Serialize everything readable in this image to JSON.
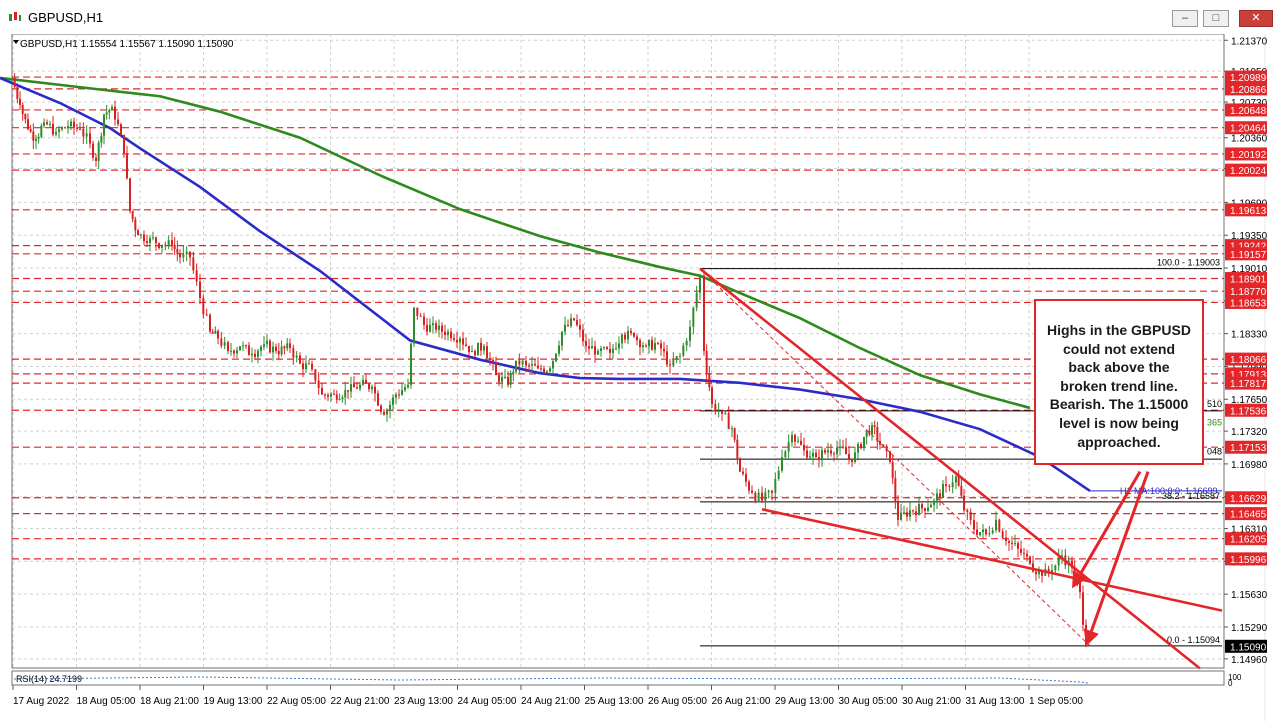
{
  "window": {
    "title": "GBPUSD,H1",
    "buttons": [
      "minimize",
      "maximize",
      "close"
    ]
  },
  "colors": {
    "price_line": "#e3262a",
    "ma100": "#2b2bc9",
    "ma200": "#2f8a1e",
    "grid": "#c8c8c8",
    "candle_up": "#2e8b2e",
    "candle_down": "#d92020"
  },
  "chart_data": {
    "type": "candlestick",
    "symbol_header": "GBPUSD,H1  1.15554 1.15567 1.15090 1.15090",
    "ylim": [
      1.14865,
      1.21435
    ],
    "y_ticks": [
      "1.21370",
      "1.21050",
      "1.20730",
      "1.20360",
      "1.20040",
      "1.19690",
      "1.19350",
      "1.19010",
      "1.18670",
      "1.18330",
      "1.17990",
      "1.17650",
      "1.17320",
      "1.16980",
      "1.16640",
      "1.16310",
      "1.15970",
      "1.15630",
      "1.15290",
      "1.14960"
    ],
    "x_ticks": [
      "17 Aug 2022",
      "18 Aug 05:00",
      "18 Aug 21:00",
      "19 Aug 13:00",
      "22 Aug 05:00",
      "22 Aug 21:00",
      "23 Aug 13:00",
      "24 Aug 05:00",
      "24 Aug 21:00",
      "25 Aug 13:00",
      "26 Aug 05:00",
      "26 Aug 21:00",
      "29 Aug 13:00",
      "30 Aug 05:00",
      "30 Aug 21:00",
      "31 Aug 13:00",
      "1 Sep 05:00"
    ],
    "horizontal_levels": [
      {
        "label": "1.20989",
        "value": 1.20989
      },
      {
        "label": "1.20866",
        "value": 1.20866
      },
      {
        "label": "1.20648",
        "value": 1.20648
      },
      {
        "label": "1.20464",
        "value": 1.20464
      },
      {
        "label": "1.20192",
        "value": 1.20192
      },
      {
        "label": "1.20024",
        "value": 1.20024
      },
      {
        "label": "1.19613",
        "value": 1.19613
      },
      {
        "label": "1.19242",
        "value": 1.19242
      },
      {
        "label": "1.19157",
        "value": 1.19157
      },
      {
        "label": "1.18901",
        "value": 1.18901
      },
      {
        "label": "1.18770",
        "value": 1.1877
      },
      {
        "label": "1.18653",
        "value": 1.18653
      },
      {
        "label": "1.18066",
        "value": 1.18066
      },
      {
        "label": "1.17913",
        "value": 1.17913
      },
      {
        "label": "1.17817",
        "value": 1.17817
      },
      {
        "label": "1.17536",
        "value": 1.17536
      },
      {
        "label": "1.17153",
        "value": 1.17153
      },
      {
        "label": "1.16629",
        "value": 1.16629
      },
      {
        "label": "1.16465",
        "value": 1.16465
      },
      {
        "label": "1.16205",
        "value": 1.16205
      },
      {
        "label": "1.15996",
        "value": 1.15996
      }
    ],
    "current_price": {
      "label": "1.15090",
      "value": 1.1509
    },
    "fibonacci": [
      {
        "label": "100.0 - 1.19003",
        "value": 1.19003
      },
      {
        "label": "38.2 - 1.16587",
        "value": 1.16587
      },
      {
        "label": "0.0 - 1.15094",
        "value": 1.15094
      }
    ],
    "fib_partial_labels": [
      {
        "label": "510"
      },
      {
        "label": "365"
      },
      {
        "label": "048"
      }
    ],
    "ma_label": "H1 MA:100:0:0: 1.16699",
    "indicator_label": "RSI(14) 24.7199",
    "rsi_scale": [
      "100",
      "0"
    ],
    "ma100": [
      [
        0,
        1.2098
      ],
      [
        60,
        1.2072
      ],
      [
        110,
        1.2046
      ],
      [
        140,
        1.2025
      ],
      [
        200,
        1.1985
      ],
      [
        260,
        1.1939
      ],
      [
        320,
        1.1898
      ],
      [
        360,
        1.1866
      ],
      [
        410,
        1.1826
      ],
      [
        480,
        1.1806
      ],
      [
        540,
        1.1792
      ],
      [
        580,
        1.1787
      ],
      [
        620,
        1.1786
      ],
      [
        680,
        1.1786
      ],
      [
        740,
        1.1782
      ],
      [
        800,
        1.1775
      ],
      [
        860,
        1.1765
      ],
      [
        920,
        1.1752
      ],
      [
        980,
        1.1734
      ],
      [
        1040,
        1.1705
      ],
      [
        1090,
        1.167
      ]
    ],
    "ma200": [
      [
        0,
        1.2098
      ],
      [
        100,
        1.2086
      ],
      [
        160,
        1.2079
      ],
      [
        220,
        1.2063
      ],
      [
        300,
        1.2036
      ],
      [
        380,
        1.1997
      ],
      [
        460,
        1.1962
      ],
      [
        540,
        1.1934
      ],
      [
        600,
        1.1917
      ],
      [
        660,
        1.1902
      ],
      [
        700,
        1.1893
      ],
      [
        740,
        1.1875
      ],
      [
        800,
        1.1849
      ],
      [
        860,
        1.1818
      ],
      [
        920,
        1.179
      ],
      [
        980,
        1.177
      ],
      [
        1030,
        1.1756
      ]
    ],
    "price_path": [
      [
        12,
        1.2098
      ],
      [
        20,
        1.207
      ],
      [
        28,
        1.2045
      ],
      [
        36,
        1.2035
      ],
      [
        44,
        1.2052
      ],
      [
        56,
        1.2042
      ],
      [
        68,
        1.2048
      ],
      [
        80,
        1.2045
      ],
      [
        90,
        1.203
      ],
      [
        96,
        1.2012
      ],
      [
        104,
        1.206
      ],
      [
        112,
        1.2068
      ],
      [
        118,
        1.205
      ],
      [
        124,
        1.202
      ],
      [
        130,
        1.196
      ],
      [
        138,
        1.1935
      ],
      [
        150,
        1.1932
      ],
      [
        162,
        1.1925
      ],
      [
        172,
        1.1925
      ],
      [
        180,
        1.1912
      ],
      [
        190,
        1.1912
      ],
      [
        200,
        1.187
      ],
      [
        210,
        1.1835
      ],
      [
        218,
        1.1828
      ],
      [
        228,
        1.1815
      ],
      [
        240,
        1.182
      ],
      [
        252,
        1.1812
      ],
      [
        264,
        1.1822
      ],
      [
        276,
        1.1815
      ],
      [
        290,
        1.1818
      ],
      [
        300,
        1.1802
      ],
      [
        312,
        1.1796
      ],
      [
        322,
        1.177
      ],
      [
        334,
        1.177
      ],
      [
        348,
        1.1773
      ],
      [
        360,
        1.178
      ],
      [
        372,
        1.1778
      ],
      [
        384,
        1.1749
      ],
      [
        396,
        1.177
      ],
      [
        408,
        1.178
      ],
      [
        414,
        1.186
      ],
      [
        424,
        1.1842
      ],
      [
        436,
        1.1837
      ],
      [
        448,
        1.1835
      ],
      [
        460,
        1.1828
      ],
      [
        472,
        1.1815
      ],
      [
        484,
        1.182
      ],
      [
        496,
        1.179
      ],
      [
        508,
        1.178
      ],
      [
        516,
        1.1805
      ],
      [
        526,
        1.18
      ],
      [
        538,
        1.1797
      ],
      [
        550,
        1.1797
      ],
      [
        562,
        1.1835
      ],
      [
        574,
        1.1847
      ],
      [
        586,
        1.182
      ],
      [
        598,
        1.1815
      ],
      [
        610,
        1.1813
      ],
      [
        622,
        1.1832
      ],
      [
        634,
        1.183
      ],
      [
        646,
        1.182
      ],
      [
        658,
        1.1823
      ],
      [
        670,
        1.18
      ],
      [
        680,
        1.181
      ],
      [
        690,
        1.184
      ],
      [
        700,
        1.1893
      ],
      [
        704,
        1.1815
      ],
      [
        712,
        1.176
      ],
      [
        722,
        1.175
      ],
      [
        732,
        1.1735
      ],
      [
        740,
        1.169
      ],
      [
        752,
        1.1668
      ],
      [
        762,
        1.166
      ],
      [
        772,
        1.1668
      ],
      [
        782,
        1.1705
      ],
      [
        792,
        1.1728
      ],
      [
        804,
        1.1712
      ],
      [
        816,
        1.1705
      ],
      [
        828,
        1.1712
      ],
      [
        840,
        1.1716
      ],
      [
        852,
        1.17
      ],
      [
        864,
        1.1726
      ],
      [
        872,
        1.1738
      ],
      [
        880,
        1.1718
      ],
      [
        890,
        1.17
      ],
      [
        898,
        1.164
      ],
      [
        910,
        1.165
      ],
      [
        922,
        1.1652
      ],
      [
        934,
        1.166
      ],
      [
        946,
        1.1675
      ],
      [
        956,
        1.1685
      ],
      [
        964,
        1.165
      ],
      [
        974,
        1.163
      ],
      [
        986,
        1.1625
      ],
      [
        996,
        1.164
      ],
      [
        1006,
        1.1618
      ],
      [
        1018,
        1.161
      ],
      [
        1030,
        1.1595
      ],
      [
        1042,
        1.1582
      ],
      [
        1052,
        1.1588
      ],
      [
        1062,
        1.1603
      ],
      [
        1072,
        1.159
      ],
      [
        1080,
        1.1565
      ],
      [
        1086,
        1.1509
      ]
    ],
    "trend_lines": [
      {
        "from": [
          700,
          1.19003
        ],
        "to": [
          1200,
          1.1486
        ]
      },
      {
        "from": [
          762,
          1.1651
        ],
        "to": [
          1222,
          1.1546
        ]
      },
      {
        "from": [
          700,
          1.19003
        ],
        "to": [
          1090,
          1.15094
        ],
        "dashed": true
      }
    ],
    "arrows": [
      {
        "from": [
          1140,
          1.169
        ],
        "to": [
          1072,
          1.1569
        ]
      },
      {
        "from": [
          1148,
          1.169
        ],
        "to": [
          1086,
          1.1509
        ]
      }
    ]
  },
  "annotation": {
    "lines": [
      "Highs in the GBPUSD",
      "could not extend",
      "back above the",
      "broken trend line.",
      "Bearish.  The 1.15000",
      "level is now being",
      "approached."
    ]
  }
}
